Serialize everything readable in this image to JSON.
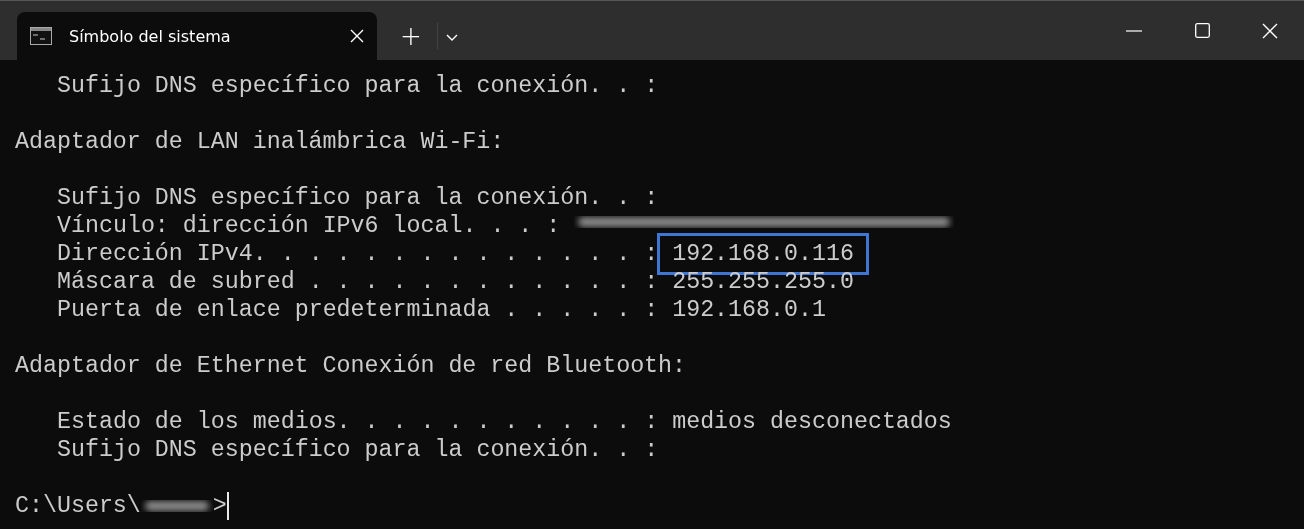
{
  "window": {
    "tab_title": "Símbolo del sistema",
    "new_tab": "+"
  },
  "lines": [
    {
      "kind": "field",
      "label": "Sufijo DNS específico para la conexión. . :"
    },
    {
      "kind": "blank"
    },
    {
      "kind": "heading",
      "label": "Adaptador de LAN inalámbrica Wi-Fi:"
    },
    {
      "kind": "blank"
    },
    {
      "kind": "field",
      "label": "Sufijo DNS específico para la conexión. . :"
    },
    {
      "kind": "field",
      "label": "Vínculo: dirección IPv6 local. . . :",
      "redacted": true
    },
    {
      "kind": "field",
      "label": "Dirección IPv4. . . . . . . . . . . . . . :",
      "value": "192.168.0.116",
      "highlighted": true
    },
    {
      "kind": "field",
      "label": "Máscara de subred . . . . . . . . . . . . :",
      "value": "255.255.255.0",
      "highlighted": false
    },
    {
      "kind": "field",
      "label": "Puerta de enlace predeterminada . . . . . :",
      "value": "192.168.0.1",
      "highlighted": false
    },
    {
      "kind": "blank"
    },
    {
      "kind": "heading",
      "label": "Adaptador de Ethernet Conexión de red Bluetooth:"
    },
    {
      "kind": "blank"
    },
    {
      "kind": "field",
      "label": "Estado de los medios. . . . . . . . . . . :",
      "value": "medios desconectados",
      "highlighted": false
    },
    {
      "kind": "field",
      "label": "Sufijo DNS específico para la conexión. . :"
    },
    {
      "kind": "blank"
    },
    {
      "kind": "prompt",
      "label": "C:\\Users\\",
      "redacted": true,
      "suffix": ">"
    }
  ]
}
